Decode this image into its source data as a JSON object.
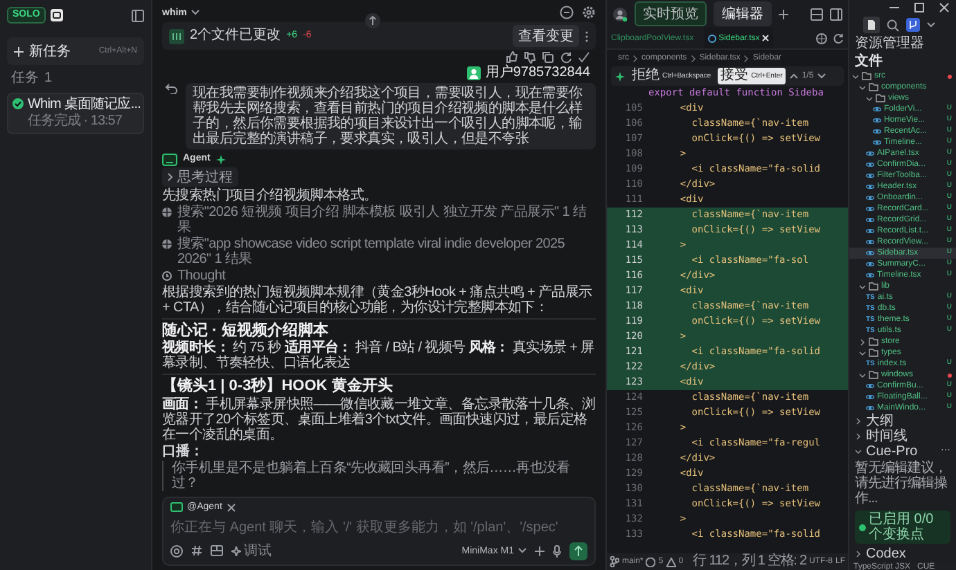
{
  "sidebar": {
    "logo": "SOLO",
    "new_task": {
      "label": "新任务",
      "shortcut": "Ctrl+Alt+N"
    },
    "section": {
      "title": "任务",
      "count": "1"
    },
    "tasks": [
      {
        "title": "Whim 桌面随记应...",
        "subtitle": "任务完成 · 13:57",
        "done": true,
        "selected": true
      }
    ]
  },
  "chat": {
    "workspace": "whim",
    "changes": {
      "label": "2个文件已更改",
      "added": "+6",
      "removed": "-6",
      "button": "查看变更"
    },
    "user": {
      "name": "用户9785732844",
      "message": "现在我需要制作视频来介绍我这个项目，需要吸引人，现在需要你帮我先去网络搜索，查看目前热门的项目介绍视频的脚本是什么样子的，然后你需要根据我的项目来设计出一个吸引人的脚本呢，输出最后完整的演讲稿子，要求真实，吸引人，但是不夸张"
    },
    "agent": {
      "name": "Agent",
      "steps": [
        {
          "kind": "toggle",
          "text": "思考过程"
        },
        {
          "kind": "text",
          "text": "先搜索热门项目介绍视频脚本格式。"
        },
        {
          "kind": "search",
          "text": "搜索\"2026 短视频 项目介绍 脚本模板 吸引人 独立开发 产品展示\" 1 结果"
        },
        {
          "kind": "search",
          "text": "搜索\"app showcase video script template viral indie developer 2025 2026\" 1 结果"
        },
        {
          "kind": "thought",
          "text": "Thought"
        },
        {
          "kind": "text",
          "text": "根据搜索到的热门短视频脚本规律（黄金3秒Hook + 痛点共鸣 + 产品展示 + CTA），结合随心记项目的核心功能，为你设计完整脚本如下："
        },
        {
          "kind": "title",
          "text": "随心记 · 短视频介绍脚本"
        },
        {
          "kind": "text",
          "text": "**视频时长：** 约 75 秒 **适用平台：** 抖音 / B站 / 视频号 **风格：** 真实场景 + 屏幕录制、节奏轻快、口语化表达"
        },
        {
          "kind": "section",
          "text": "【镜头1 | 0-3秒】HOOK 黄金开头"
        },
        {
          "kind": "text",
          "text": "**画面：** 手机屏幕录屏快照——微信收藏一堆文章、备忘录散落十几条、浏览器开了20个标签页、桌面上堆着3个txt文件。画面快速闪过，最后定格在一个凌乱的桌面。"
        },
        {
          "kind": "label",
          "text": "口播："
        },
        {
          "kind": "quote",
          "text": "你手机里是不是也躺着上百条“先收藏回头再看”，然后……再也没看过？"
        }
      ]
    },
    "composer": {
      "mention": "@Agent",
      "placeholder": "你正在与 Agent 聊天，输入 '/' 获取更多能力，如 '/plan'、'/spec'",
      "mode": "调试",
      "model": "MiniMax M1"
    }
  },
  "editor": {
    "view_tabs": [
      {
        "label": "实时预览",
        "selected": false
      },
      {
        "label": "编辑器",
        "selected": true
      }
    ],
    "file_tabs": [
      {
        "label": "ClipboardPoolView.tsx",
        "selected": false
      },
      {
        "label": "Sidebar.tsx",
        "selected": true
      }
    ],
    "breadcrumb": [
      "src",
      "components",
      "Sidebar.tsx",
      "Sidebar"
    ],
    "diff": {
      "reject": "拒绝",
      "reject_key": "Ctrl+Backspace",
      "accept": "接受",
      "accept_key": "Ctrl+Enter",
      "position": "1/5"
    },
    "sticky": "export default function Sideba",
    "lines": [
      {
        "number": "105",
        "text": "    <div",
        "added": false
      },
      {
        "number": "106",
        "text": "      className={`nav-item",
        "added": false
      },
      {
        "number": "107",
        "text": "      onClick={() => setView",
        "added": false
      },
      {
        "number": "108",
        "text": "    >",
        "added": false
      },
      {
        "number": "109",
        "text": "      <i className=\"fa-solid",
        "added": false
      },
      {
        "number": "110",
        "text": "    </div>",
        "added": false
      },
      {
        "number": "111",
        "text": "    <div",
        "added": false
      },
      {
        "number": "112",
        "text": "      className={`nav-item",
        "added": true
      },
      {
        "number": "113",
        "text": "      onClick={() => setView",
        "added": true
      },
      {
        "number": "114",
        "text": "    >",
        "added": true
      },
      {
        "number": "115",
        "text": "      <i className=\"fa-sol",
        "added": true
      },
      {
        "number": "116",
        "text": "    </div>",
        "added": true
      },
      {
        "number": "117",
        "text": "    <div",
        "added": true
      },
      {
        "number": "118",
        "text": "      className={`nav-item",
        "added": true
      },
      {
        "number": "119",
        "text": "      onClick={() => setView",
        "added": true
      },
      {
        "number": "120",
        "text": "    >",
        "added": true
      },
      {
        "number": "121",
        "text": "      <i className=\"fa-solid",
        "added": true
      },
      {
        "number": "122",
        "text": "    </div>",
        "added": true
      },
      {
        "number": "123",
        "text": "    <div",
        "added": true
      },
      {
        "number": "124",
        "text": "      className={`nav-item",
        "added": false
      },
      {
        "number": "125",
        "text": "      onClick={() => setView",
        "added": false
      },
      {
        "number": "126",
        "text": "    >",
        "added": false
      },
      {
        "number": "127",
        "text": "      <i className=\"fa-regul",
        "added": false
      },
      {
        "number": "128",
        "text": "    </div>",
        "added": false
      },
      {
        "number": "129",
        "text": "    <div",
        "added": false
      },
      {
        "number": "130",
        "text": "      className={`nav-item",
        "added": false
      },
      {
        "number": "131",
        "text": "      onClick={() => setView",
        "added": false
      },
      {
        "number": "132",
        "text": "    >",
        "added": false
      },
      {
        "number": "133",
        "text": "      <i className=\"fa-solid",
        "added": false
      }
    ],
    "status": {
      "branch": "main*",
      "errors": "5",
      "warnings": "0",
      "position": "行 112，列 1",
      "items": [
        "空格: 2",
        "UTF-8",
        "LF"
      ]
    }
  },
  "explorer": {
    "title": "资源管理器",
    "section": "文件",
    "tree": [
      {
        "name": "src",
        "kind": "folder",
        "expanded": true,
        "modified": true,
        "selected": false,
        "children": [
          {
            "name": "components",
            "kind": "folder",
            "expanded": true,
            "modified": false,
            "selected": false,
            "children": [
              {
                "name": "views",
                "kind": "folder",
                "expanded": true,
                "modified": false,
                "selected": false,
                "children": [
                  {
                    "name": "FolderVi...",
                    "kind": "react",
                    "status": "U",
                    "selected": false
                  },
                  {
                    "name": "HomeVie...",
                    "kind": "react",
                    "status": "U",
                    "selected": false
                  },
                  {
                    "name": "RecentAc...",
                    "kind": "react",
                    "status": "U",
                    "selected": false
                  },
                  {
                    "name": "Timeline...",
                    "kind": "react",
                    "status": "U",
                    "selected": false
                  }
                ]
              },
              {
                "name": "AIPanel.tsx",
                "kind": "react",
                "status": "U",
                "selected": false
              },
              {
                "name": "ConfirmDia...",
                "kind": "react",
                "status": "U",
                "selected": false
              },
              {
                "name": "FilterToolba...",
                "kind": "react",
                "status": "U",
                "selected": false
              },
              {
                "name": "Header.tsx",
                "kind": "react",
                "status": "U",
                "selected": false
              },
              {
                "name": "Onboardin...",
                "kind": "react",
                "status": "U",
                "selected": false
              },
              {
                "name": "RecordCard...",
                "kind": "react",
                "status": "U",
                "selected": false
              },
              {
                "name": "RecordGrid...",
                "kind": "react",
                "status": "U",
                "selected": false
              },
              {
                "name": "RecordList.t...",
                "kind": "react",
                "status": "U",
                "selected": false
              },
              {
                "name": "RecordView...",
                "kind": "react",
                "status": "U",
                "selected": false
              },
              {
                "name": "Sidebar.tsx",
                "kind": "react",
                "status": "U",
                "selected": true
              },
              {
                "name": "SummaryC...",
                "kind": "react",
                "status": "U",
                "selected": false
              },
              {
                "name": "Timeline.tsx",
                "kind": "react",
                "status": "U",
                "selected": false
              }
            ]
          },
          {
            "name": "lib",
            "kind": "folder",
            "expanded": true,
            "modified": false,
            "selected": false,
            "children": [
              {
                "name": "ai.ts",
                "kind": "ts",
                "badge": "TS",
                "status": "U",
                "selected": false
              },
              {
                "name": "db.ts",
                "kind": "ts",
                "badge": "TS",
                "status": "U",
                "selected": false
              },
              {
                "name": "theme.ts",
                "kind": "ts",
                "badge": "TS",
                "status": "U",
                "selected": false
              },
              {
                "name": "utils.ts",
                "kind": "ts",
                "badge": "TS",
                "status": "U",
                "selected": false
              }
            ]
          },
          {
            "name": "store",
            "kind": "folder",
            "expanded": false,
            "modified": false,
            "selected": false
          },
          {
            "name": "types",
            "kind": "folder",
            "expanded": true,
            "modified": false,
            "selected": false,
            "children": [
              {
                "name": "index.ts",
                "kind": "ts",
                "badge": "TS",
                "status": "U",
                "selected": false
              }
            ]
          },
          {
            "name": "windows",
            "kind": "folder",
            "expanded": true,
            "modified": true,
            "selected": false,
            "children": [
              {
                "name": "ConfirmBu...",
                "kind": "react",
                "status": "U",
                "selected": false
              },
              {
                "name": "FloatingBall...",
                "kind": "react",
                "status": "U",
                "selected": false
              },
              {
                "name": "MainWindo...",
                "kind": "react",
                "status": "U",
                "selected": false
              }
            ]
          }
        ]
      }
    ],
    "panels": [
      {
        "title": "大纲",
        "expanded": false
      },
      {
        "title": "时间线",
        "expanded": false
      },
      {
        "title": "Cue-Pro",
        "expanded": true,
        "menu": "···",
        "message": "暂无编辑建议，请先进行编辑操作...",
        "button": "已启用 0/0 个变换点"
      },
      {
        "title": "Codex",
        "expanded": false
      }
    ],
    "status": [
      "TypeScript JSX",
      "CUE"
    ]
  }
}
